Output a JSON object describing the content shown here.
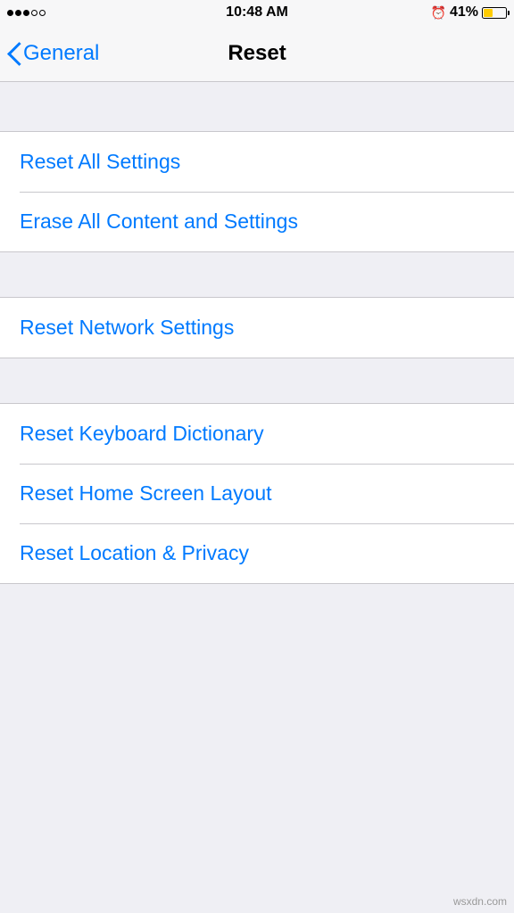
{
  "statusBar": {
    "time": "10:48 AM",
    "batteryPercent": "41%"
  },
  "nav": {
    "back": "General",
    "title": "Reset"
  },
  "groups": [
    {
      "items": [
        {
          "id": "reset-all-settings",
          "label": "Reset All Settings"
        },
        {
          "id": "erase-all-content",
          "label": "Erase All Content and Settings"
        }
      ]
    },
    {
      "items": [
        {
          "id": "reset-network-settings",
          "label": "Reset Network Settings"
        }
      ]
    },
    {
      "items": [
        {
          "id": "reset-keyboard-dictionary",
          "label": "Reset Keyboard Dictionary"
        },
        {
          "id": "reset-home-screen-layout",
          "label": "Reset Home Screen Layout"
        },
        {
          "id": "reset-location-privacy",
          "label": "Reset Location & Privacy"
        }
      ]
    }
  ],
  "watermark": "wsxdn.com"
}
